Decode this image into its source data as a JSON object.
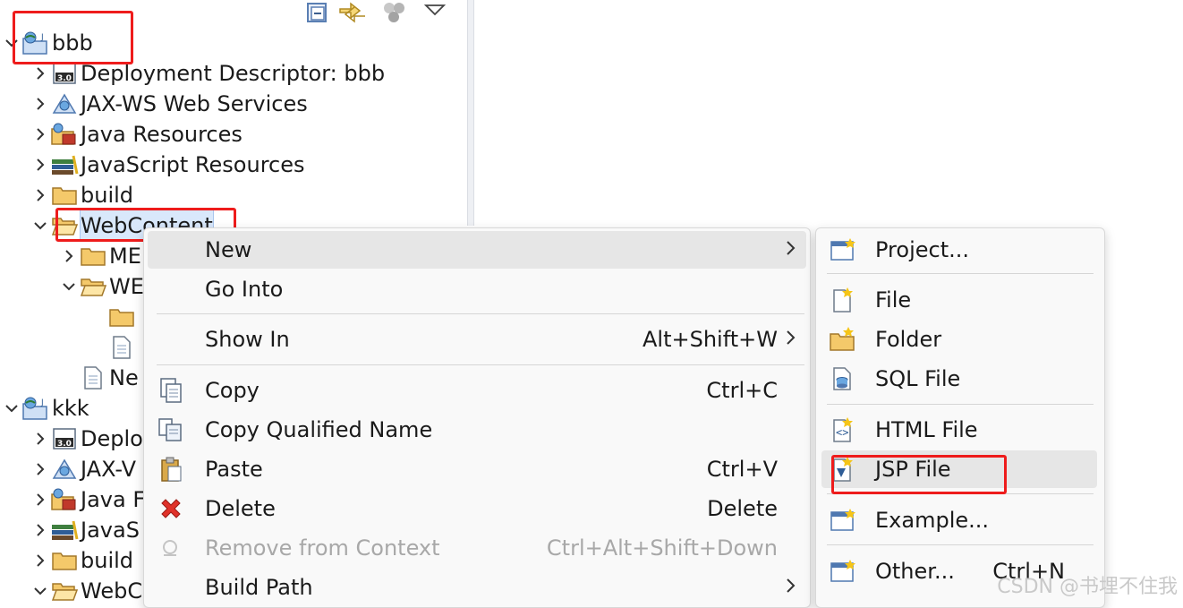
{
  "tree": {
    "items": [
      {
        "label": "bbb",
        "icon": "web-project-icon",
        "expanded": true
      },
      {
        "label": "Deployment Descriptor: bbb",
        "icon": "deployment-descriptor-icon",
        "expanded": false
      },
      {
        "label": "JAX-WS Web Services",
        "icon": "jaxws-icon",
        "expanded": false
      },
      {
        "label": "Java Resources",
        "icon": "java-resources-icon",
        "expanded": false
      },
      {
        "label": "JavaScript Resources",
        "icon": "javascript-resources-icon",
        "expanded": false
      },
      {
        "label": "build",
        "icon": "folder-icon",
        "expanded": false
      },
      {
        "label": "WebContent",
        "icon": "folder-open-icon",
        "expanded": true
      },
      {
        "label": "ME",
        "icon": "folder-icon",
        "expanded": false
      },
      {
        "label": "WE",
        "icon": "folder-open-icon",
        "expanded": true
      },
      {
        "label": "",
        "icon": "folder-icon"
      },
      {
        "label": "",
        "icon": "file-icon"
      },
      {
        "label": "Ne",
        "icon": "file-icon"
      },
      {
        "label": "kkk",
        "icon": "web-project-icon",
        "expanded": true
      },
      {
        "label": "Deplo",
        "icon": "deployment-descriptor-icon",
        "expanded": false
      },
      {
        "label": "JAX-V",
        "icon": "jaxws-icon",
        "expanded": false
      },
      {
        "label": "Java F",
        "icon": "java-resources-icon",
        "expanded": false
      },
      {
        "label": "JavaS",
        "icon": "javascript-resources-icon",
        "expanded": false
      },
      {
        "label": "build",
        "icon": "folder-icon",
        "expanded": false
      },
      {
        "label": "WebC",
        "icon": "folder-open-icon",
        "expanded": true
      }
    ]
  },
  "context_menu": {
    "items": [
      {
        "label": "New",
        "shortcut": "",
        "submenu": true
      },
      {
        "label": "Go Into",
        "shortcut": ""
      },
      {
        "label": "Show In",
        "shortcut": "Alt+Shift+W",
        "submenu": true
      },
      {
        "label": "Copy",
        "shortcut": "Ctrl+C",
        "icon": "copy-icon"
      },
      {
        "label": "Copy Qualified Name",
        "shortcut": "",
        "icon": "copy-qualified-name-icon"
      },
      {
        "label": "Paste",
        "shortcut": "Ctrl+V",
        "icon": "paste-icon"
      },
      {
        "label": "Delete",
        "shortcut": "Delete",
        "icon": "delete-icon"
      },
      {
        "label": "Remove from Context",
        "shortcut": "Ctrl+Alt+Shift+Down",
        "icon": "remove-context-icon",
        "disabled": true
      },
      {
        "label": "Build Path",
        "shortcut": "",
        "submenu": true
      }
    ]
  },
  "new_submenu": {
    "items": [
      {
        "label": "Project...",
        "icon": "new-project-icon"
      },
      {
        "label": "File",
        "icon": "new-file-icon"
      },
      {
        "label": "Folder",
        "icon": "new-folder-icon"
      },
      {
        "label": "SQL File",
        "icon": "new-sql-file-icon"
      },
      {
        "label": "HTML File",
        "icon": "new-html-file-icon"
      },
      {
        "label": "JSP File",
        "icon": "new-jsp-file-icon"
      },
      {
        "label": "Example...",
        "icon": "new-example-icon"
      },
      {
        "label": "Other...",
        "shortcut": "Ctrl+N",
        "icon": "new-other-icon"
      }
    ]
  },
  "colors": {
    "highlight_box": "#ee1c1c",
    "selection": "#d9e8fb",
    "menu_bg": "#f9f9f9"
  },
  "watermark": "CSDN @书埋不住我"
}
